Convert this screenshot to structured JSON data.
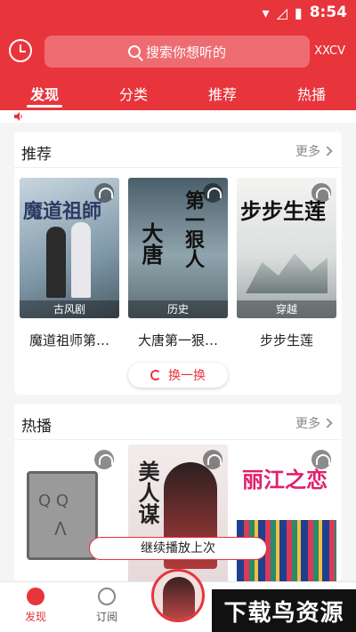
{
  "status_bar": {
    "time": "8:54"
  },
  "header": {
    "search": {
      "placeholder": "搜索你想听的"
    },
    "user_label": "XXCV",
    "tabs": [
      {
        "label": "发现",
        "active": true
      },
      {
        "label": "分类"
      },
      {
        "label": "推荐"
      },
      {
        "label": "热播"
      }
    ]
  },
  "recommend": {
    "title": "推荐",
    "more_label": "更多",
    "books": [
      {
        "title": "魔道祖师第…",
        "tag": "古风剧",
        "cover_text": "魔道祖師"
      },
      {
        "title": "大唐第一狠…",
        "tag": "历史",
        "cover_text": "第一狠人"
      },
      {
        "title": "步步生莲",
        "tag": "穿越",
        "cover_text": "步步生莲"
      }
    ],
    "swap_label": "换一换"
  },
  "hot": {
    "title": "热播",
    "more_label": "更多",
    "books": [
      {
        "cover_text": "Q Q"
      },
      {
        "cover_text": "美人谋"
      },
      {
        "cover_text": "丽江之恋"
      }
    ]
  },
  "resume_label": "继续播放上次",
  "bottom_nav": [
    {
      "label": "发现",
      "active": true
    },
    {
      "label": "订阅"
    }
  ],
  "watermark": "下载鸟资源",
  "colors": {
    "accent": "#e8343b"
  }
}
